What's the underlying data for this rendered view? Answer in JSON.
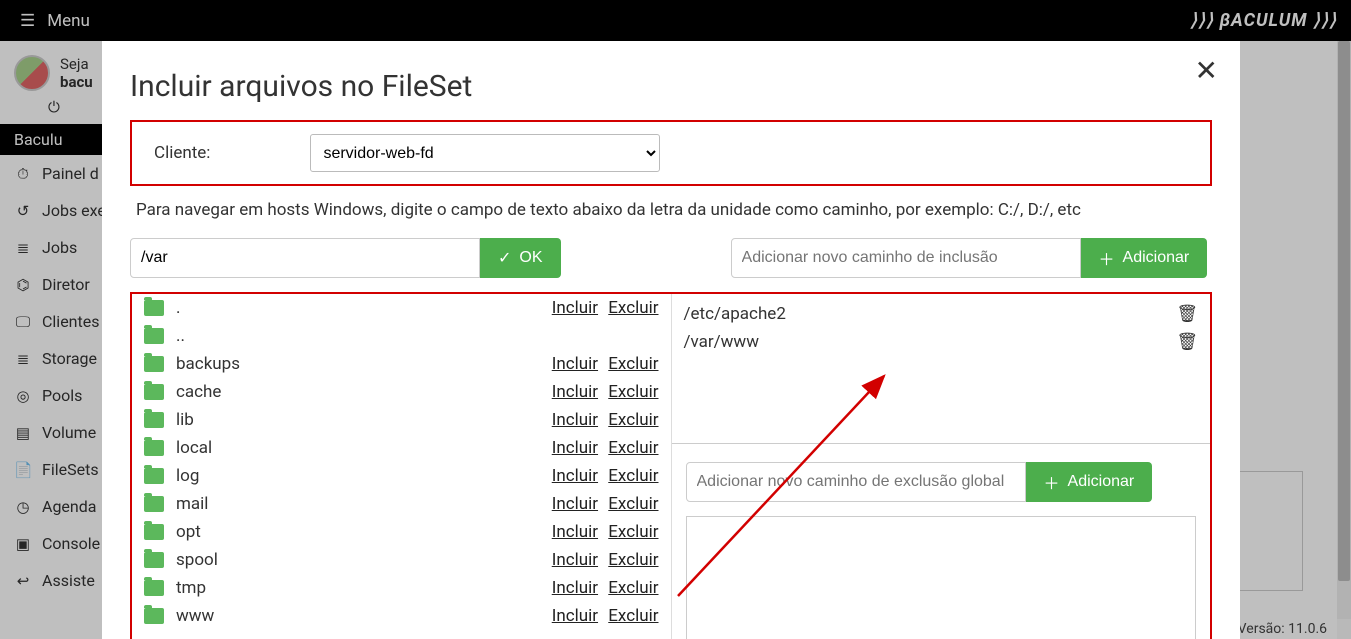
{
  "topbar": {
    "menu": "Menu",
    "brand": "⟩⟩⟩ βACULUM ⟩⟩⟩"
  },
  "sidebar": {
    "welcome_prefix": "Seja",
    "username": "bacu",
    "section_title": "Baculu",
    "items": [
      {
        "icon": "dash",
        "label": "Painel d"
      },
      {
        "icon": "history",
        "label": "Jobs exe"
      },
      {
        "icon": "list",
        "label": "Jobs"
      },
      {
        "icon": "sitemap",
        "label": "Diretor"
      },
      {
        "icon": "display",
        "label": "Clientes"
      },
      {
        "icon": "db",
        "label": "Storage"
      },
      {
        "icon": "circle",
        "label": "Pools"
      },
      {
        "icon": "hdd",
        "label": "Volume"
      },
      {
        "icon": "filesets",
        "label": "FileSets"
      },
      {
        "icon": "clock",
        "label": "Agenda"
      },
      {
        "icon": "console",
        "label": "Console"
      },
      {
        "icon": "wizard",
        "label": "Assiste"
      }
    ]
  },
  "modal": {
    "title": "Incluir arquivos no FileSet",
    "client_label": "Cliente:",
    "client_value": "servidor-web-fd",
    "hint": "Para navegar em hosts Windows, digite o campo de texto abaixo da letra da unidade como caminho, por exemplo: C:/, D:/, etc",
    "path_value": "/var",
    "ok_label": "OK",
    "include_new_placeholder": "Adicionar novo caminho de inclusão",
    "exclude_new_placeholder": "Adicionar novo caminho de exclusão global",
    "add_label": "Adicionar",
    "include_action": "Incluir",
    "exclude_action": "Excluir",
    "dirs": [
      {
        "name": ".",
        "actions": true
      },
      {
        "name": "..",
        "actions": false
      },
      {
        "name": "backups",
        "actions": true
      },
      {
        "name": "cache",
        "actions": true
      },
      {
        "name": "lib",
        "actions": true
      },
      {
        "name": "local",
        "actions": true
      },
      {
        "name": "log",
        "actions": true
      },
      {
        "name": "mail",
        "actions": true
      },
      {
        "name": "opt",
        "actions": true
      },
      {
        "name": "spool",
        "actions": true
      },
      {
        "name": "tmp",
        "actions": true
      },
      {
        "name": "www",
        "actions": true
      }
    ],
    "included_paths": [
      "/etc/apache2",
      "/var/www"
    ]
  },
  "footer": {
    "version": "Versão: 11.0.6"
  }
}
